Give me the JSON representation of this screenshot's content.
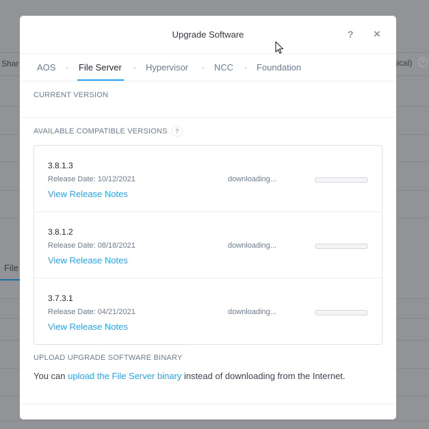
{
  "background": {
    "left_tab_text": "Shar",
    "left_tab_text_2": "File",
    "right_text": "ogical)"
  },
  "modal": {
    "title": "Upgrade Software",
    "help_label": "?",
    "close_label": "×",
    "tabs": [
      {
        "label": "AOS",
        "active": false
      },
      {
        "label": "File Server",
        "active": true
      },
      {
        "label": "Hypervisor",
        "active": false
      },
      {
        "label": "NCC",
        "active": false
      },
      {
        "label": "Foundation",
        "active": false
      }
    ],
    "tab_separator": "·",
    "current_version_label": "CURRENT VERSION",
    "available_label": "AVAILABLE COMPATIBLE VERSIONS",
    "available_help": "?",
    "versions": [
      {
        "version": "3.8.1.3",
        "release_date": "Release Date: 10/12/2021",
        "notes_link": "View Release Notes",
        "status": "downloading...",
        "progress": 0
      },
      {
        "version": "3.8.1.2",
        "release_date": "Release Date: 08/18/2021",
        "notes_link": "View Release Notes",
        "status": "downloading...",
        "progress": 0
      },
      {
        "version": "3.7.3.1",
        "release_date": "Release Date: 04/21/2021",
        "notes_link": "View Release Notes",
        "status": "downloading...",
        "progress": 0
      }
    ],
    "upload_label": "UPLOAD UPGRADE SOFTWARE BINARY",
    "upload_prefix": "You can ",
    "upload_link": "upload the File Server binary",
    "upload_suffix": " instead of downloading from the Internet."
  },
  "colors": {
    "accent": "#22a5f7",
    "overlay": "#929396"
  }
}
